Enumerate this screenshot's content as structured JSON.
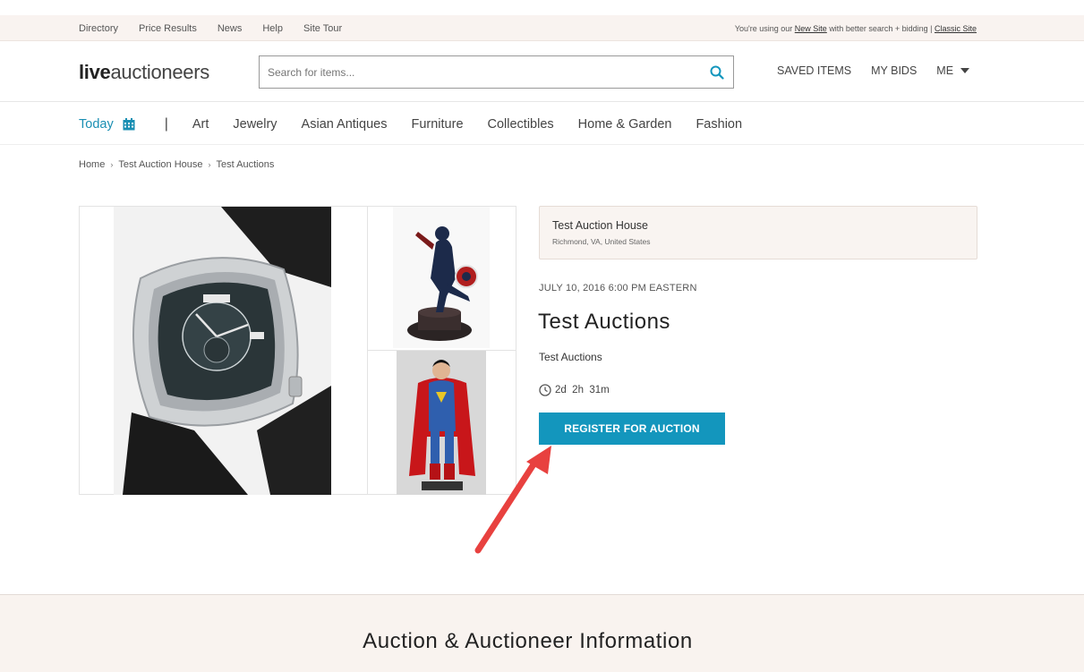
{
  "utility_bar": {
    "links": [
      "Directory",
      "Price Results",
      "News",
      "Help",
      "Site Tour"
    ],
    "notice_prefix": "You're using our",
    "new_site_link": "New Site",
    "notice_middle": "with better search + bidding |",
    "classic_site_link": "Classic Site"
  },
  "header": {
    "logo_bold": "live",
    "logo_light": "auctioneers",
    "search_placeholder": "Search for items...",
    "saved_items": "SAVED ITEMS",
    "my_bids": "MY BIDS",
    "me": "ME"
  },
  "category_nav": {
    "today": "Today",
    "separator": "|",
    "categories": [
      "Art",
      "Jewelry",
      "Asian Antiques",
      "Furniture",
      "Collectibles",
      "Home & Garden",
      "Fashion"
    ]
  },
  "breadcrumb": [
    "Home",
    "Test Auction House",
    "Test Auctions"
  ],
  "auction": {
    "house_name": "Test Auction House",
    "house_location": "Richmond, VA, United States",
    "date": "JULY 10, 2016 6:00 PM EASTERN",
    "title": "Test Auctions",
    "description": "Test Auctions",
    "countdown": "2d  2h  31m",
    "register_label": "REGISTER FOR AUCTION"
  },
  "info_section": {
    "title": "Auction & Auctioneer Information"
  },
  "colors": {
    "accent": "#1396bd",
    "annotation_arrow": "#e8413f"
  }
}
